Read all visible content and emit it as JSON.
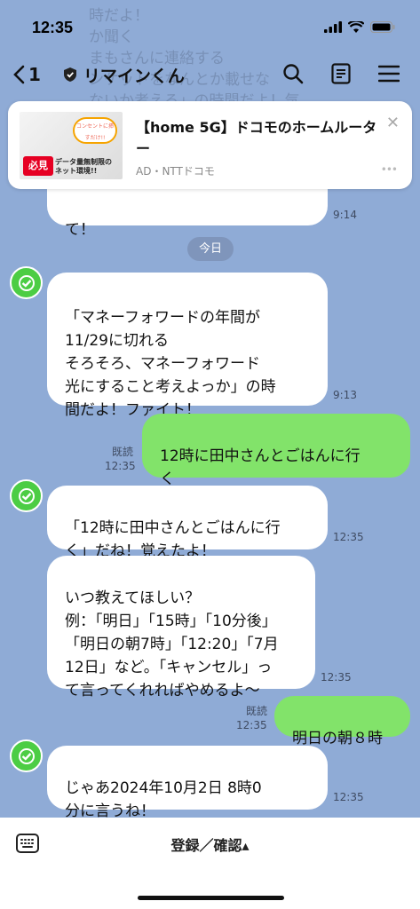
{
  "status": {
    "time": "12:35"
  },
  "header": {
    "back_count": "1",
    "title": "リマインくん"
  },
  "background_text": "時だよ！\nか聞く\nまもさんに連絡する\nンケットをなんとか載せな\nないか考える」の時間だよ！気",
  "ad": {
    "title": "【home 5G】ドコモのホームルーター",
    "sponsor": "AD・NTTドコモ",
    "image_badge": "必見",
    "image_chip": "コンセントに挿すだけ!!",
    "image_strip": "データ量無制限の ネット環境!!"
  },
  "messages": {
    "m0_text": "て！",
    "m0_time": "9:14",
    "date_label": "今日",
    "m1_text": "「マネーフォワードの年間が\n11/29に切れる\nそろそろ、マネーフォワード\n光にすること考えよっか」の時\n間だよ！ファイト！",
    "m1_time": "9:13",
    "m2_text": "12時に田中さんとごはんに行\nく",
    "m2_read": "既読",
    "m2_time": "12:35",
    "m3_text": "「12時に田中さんとごはんに行\nく」だね！覚えたよ！",
    "m3_time": "12:35",
    "m4_text": "いつ教えてほしい？\n例：「明日」「15時」「10分後」\n「明日の朝7時」「12:20」「7月\n12日」など。「キャンセル」っ\nて言ってくれればやめるよ〜",
    "m4_time": "12:35",
    "m5_text": "明日の朝８時",
    "m5_read": "既読",
    "m5_time": "12:35",
    "m6_text": "じゃあ2024年10月2日 8時0\n分に言うね！",
    "m6_time": "12:35"
  },
  "bottom": {
    "label": "登録／確認▴"
  }
}
